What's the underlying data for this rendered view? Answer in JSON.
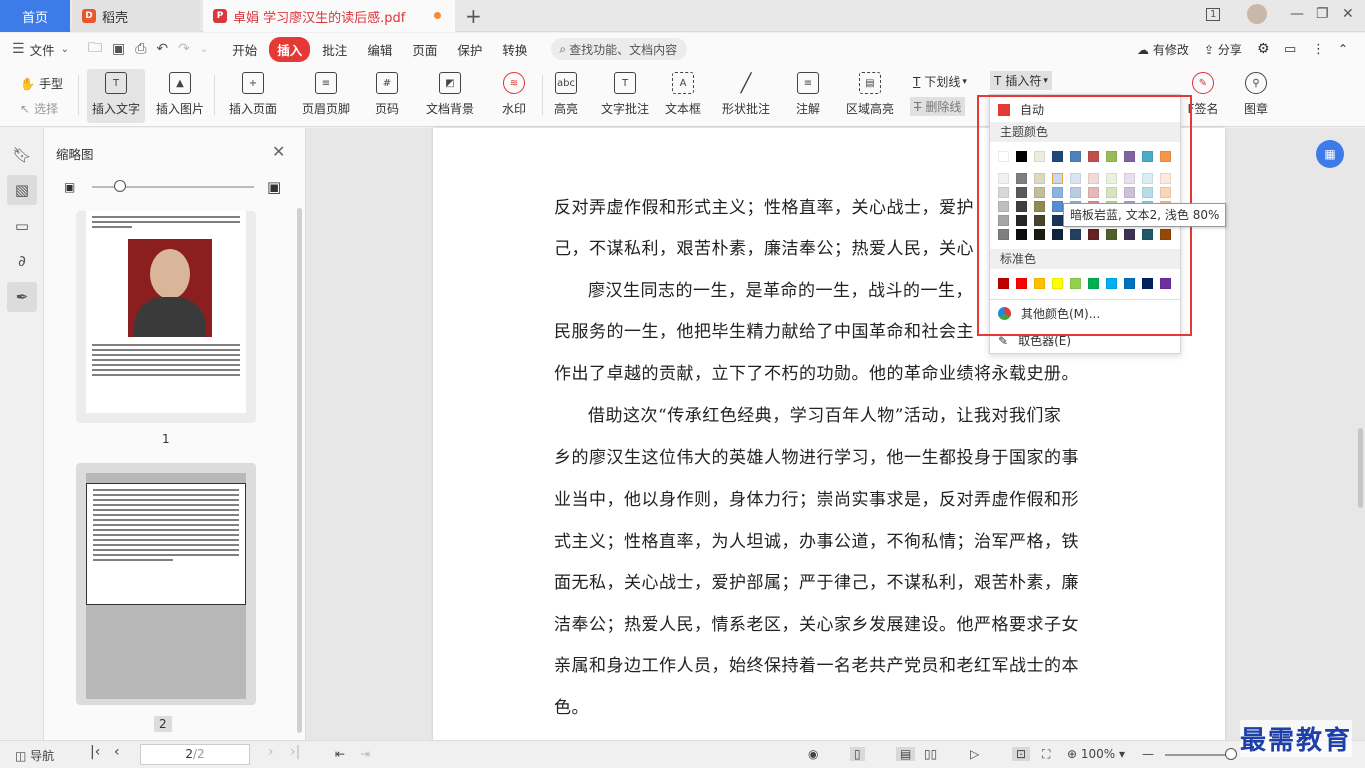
{
  "tabs": {
    "home": "首页",
    "daoke": "稻壳",
    "doc": "卓娟 学习廖汉生的读后感.pdf"
  },
  "window": {
    "page_indicator": "1"
  },
  "menu": {
    "file": "文件",
    "items": [
      "开始",
      "插入",
      "批注",
      "编辑",
      "页面",
      "保护",
      "转换"
    ],
    "active": "插入",
    "search_placeholder": "查找功能、文档内容",
    "modified": "有修改",
    "share": "分享"
  },
  "ribbon": {
    "hand": "手型",
    "select": "选择",
    "insert_text": "插入文字",
    "insert_image": "插入图片",
    "insert_page": "插入页面",
    "header_footer": "页眉页脚",
    "page_number": "页码",
    "doc_background": "文档背景",
    "watermark": "水印",
    "highlight": "高亮",
    "text_comment": "文字批注",
    "text_box": "文本框",
    "shape_comment": "形状批注",
    "annotation": "注解",
    "area_highlight": "区域高亮",
    "underline": "下划线",
    "strikethrough": "删除线",
    "insert_symbol": "插入符",
    "sign_partial": "F签名",
    "stamp": "图章"
  },
  "thumbs": {
    "title": "缩略图",
    "page1": "1",
    "page2": "2"
  },
  "document": {
    "lines": [
      "反对弄虚作假和形式主义；性格直率，关心战士，爱护",
      "己，不谋私利，艰苦朴素，廉洁奉公；热爱人民，关心",
      "廖汉生同志的一生，是革命的一生，战斗的一生，",
      "民服务的一生，他把毕生精力献给了中国革命和社会主",
      "作出了卓越的贡献，立下了不朽的功勋。他的革命业绩将永载史册。",
      "借助这次“传承红色经典，学习百年人物”活动，让我对我们家",
      "乡的廖汉生这位伟大的英雄人物进行学习，他一生都投身于国家的事",
      "业当中，他以身作则，身体力行；崇尚实事求是，反对弄虚作假和形",
      "式主义；性格直率，为人坦诚，办事公道，不徇私情；治军严格，铁",
      "面无私，关心战士，爱护部属；严于律己，不谋私利，艰苦朴素，廉",
      "洁奉公；热爱人民，情系老区，关心家乡发展建设。他严格要求子女",
      "亲属和身边工作人员，始终保持着一名老共产党员和老红军战士的本",
      "色。"
    ]
  },
  "dropdown": {
    "auto": "自动",
    "theme_colors": "主题颜色",
    "standard_colors": "标准色",
    "more_colors": "其他颜色(M)...",
    "picker": "取色器(E)",
    "tooltip": "暗板岩蓝, 文本2, 浅色 80%",
    "auto_color": "#e53935",
    "theme_top": [
      "#ffffff",
      "#000000",
      "#eeece1",
      "#1f497d",
      "#4f81bd",
      "#c0504d",
      "#9bbb59",
      "#8064a2",
      "#4bacc6",
      "#f79646"
    ],
    "theme_shades": [
      [
        "#f2f2f2",
        "#7f7f7f",
        "#ddd9c3",
        "#c6d9f0",
        "#dbe5f1",
        "#f2dcdb",
        "#ebf1dd",
        "#e5e0ec",
        "#dbeef3",
        "#fdeada"
      ],
      [
        "#d8d8d8",
        "#595959",
        "#c4bd97",
        "#8db3e2",
        "#b8cce4",
        "#e5b9b7",
        "#d7e3bc",
        "#ccc1d9",
        "#b7dde8",
        "#fbd5b5"
      ],
      [
        "#bfbfbf",
        "#3f3f3f",
        "#938953",
        "#548dd4",
        "#95b3d7",
        "#d99694",
        "#c3d69b",
        "#b2a2c7",
        "#92cddc",
        "#fac08f"
      ],
      [
        "#a5a5a5",
        "#262626",
        "#494429",
        "#17365d",
        "#366092",
        "#953734",
        "#76923c",
        "#5f497a",
        "#31859b",
        "#e36c09"
      ],
      [
        "#7f7f7f",
        "#0c0c0c",
        "#1d1b10",
        "#0f243e",
        "#244061",
        "#632423",
        "#4f6128",
        "#3f3151",
        "#205867",
        "#974806"
      ]
    ],
    "standard": [
      "#c00000",
      "#ff0000",
      "#ffc000",
      "#ffff00",
      "#92d050",
      "#00b050",
      "#00b0f0",
      "#0070c0",
      "#002060",
      "#7030a0"
    ]
  },
  "status": {
    "nav": "导航",
    "page": "2",
    "page_total": "/2",
    "zoom": "100%"
  },
  "watermark": "最需教育"
}
